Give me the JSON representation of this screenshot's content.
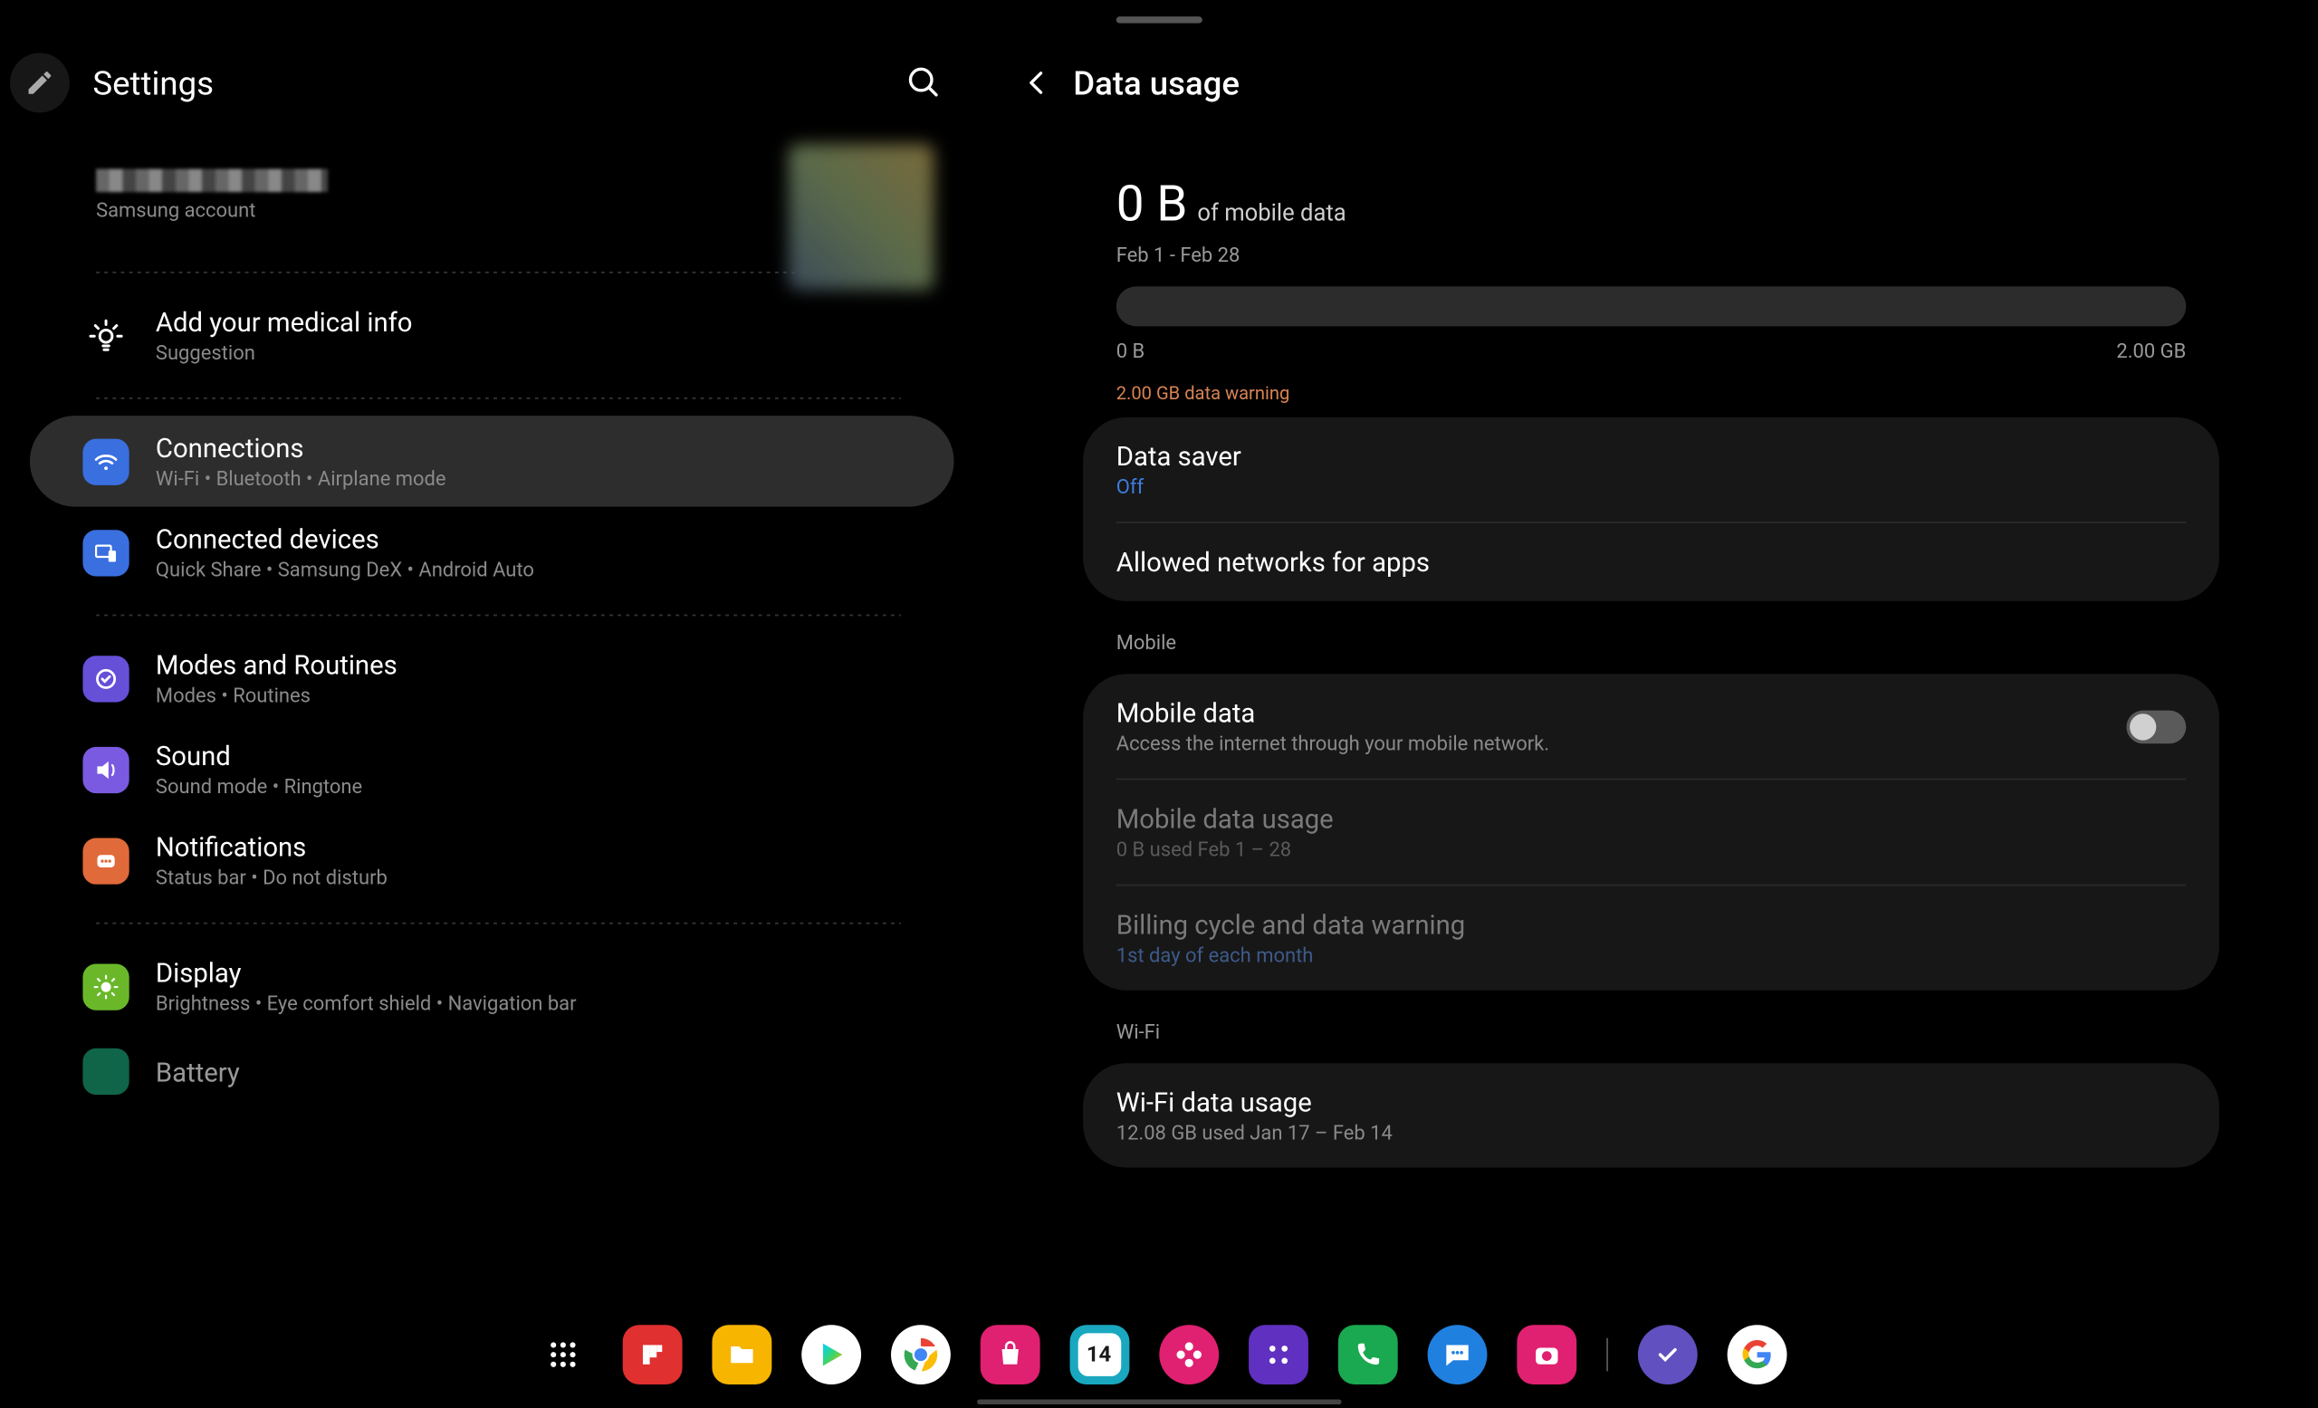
{
  "left": {
    "title": "Settings",
    "account_sub": "Samsung account",
    "medical": {
      "title": "Add your medical info",
      "sub": "Suggestion"
    },
    "items": [
      {
        "title": "Connections",
        "sub": "Wi-Fi  •  Bluetooth  •  Airplane mode"
      },
      {
        "title": "Connected devices",
        "sub": "Quick Share  •  Samsung DeX  •  Android Auto"
      },
      {
        "title": "Modes and Routines",
        "sub": "Modes  •  Routines"
      },
      {
        "title": "Sound",
        "sub": "Sound mode  •  Ringtone"
      },
      {
        "title": "Notifications",
        "sub": "Status bar  •  Do not disturb"
      },
      {
        "title": "Display",
        "sub": "Brightness  •  Eye comfort shield  •  Navigation bar"
      },
      {
        "title": "Battery",
        "sub": ""
      }
    ]
  },
  "right": {
    "title": "Data usage",
    "summary": {
      "amount": "0 B",
      "suffix": "of mobile data",
      "period": "Feb 1 - Feb 28",
      "min": "0 B",
      "max": "2.00 GB",
      "warning": "2.00 GB data warning"
    },
    "card1": [
      {
        "title": "Data saver",
        "sub": "Off"
      },
      {
        "title": "Allowed networks for apps",
        "sub": ""
      }
    ],
    "mobile_label": "Mobile",
    "card2": [
      {
        "title": "Mobile data",
        "sub": "Access the internet through your mobile network."
      },
      {
        "title": "Mobile data usage",
        "sub": "0 B used Feb 1 – 28"
      },
      {
        "title": "Billing cycle and data warning",
        "sub": "1st day of each month"
      }
    ],
    "wifi_label": "Wi-Fi",
    "card3": [
      {
        "title": "Wi-Fi data usage",
        "sub": "12.08 GB used Jan 17 – Feb 14"
      }
    ]
  },
  "taskbar": {
    "calendar_day": "14"
  }
}
